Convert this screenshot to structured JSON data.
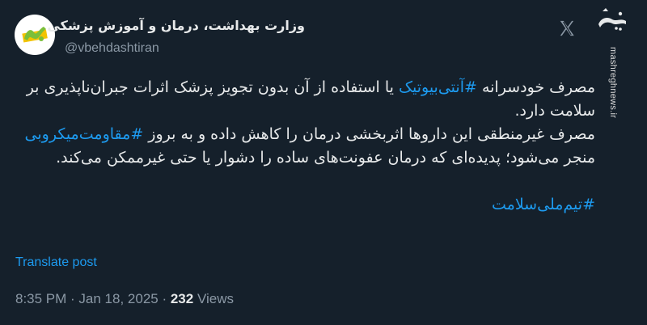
{
  "account": {
    "display_name": "وزارت بهداشت، درمان و آموزش پزشکی",
    "handle": "@vbehdashtiran",
    "avatar_icon": "ministry-logo-icon"
  },
  "header": {
    "platform_icon": "x-logo-icon"
  },
  "watermark": {
    "logo_text": "مشرق",
    "site": "mashreghnews.ir"
  },
  "tweet": {
    "p1_before": "مصرف خودسرانه ",
    "hashtag1": "#آنتی‌بیوتیک",
    "p1_after": " یا استفاده از آن بدون تجویز پزشک اثرات جبران‌ناپذیری بر سلامت دارد.",
    "p2_before": "مصرف غیرمنطقی این داروها اثربخشی درمان را کاهش داده و به بروز ",
    "hashtag2": "#مقاومت‌میکروبی",
    "p2_after": " منجر می‌شود؛ پدیده‌ای که درمان عفونت‌های ساده را دشوار یا حتی غیرممکن می‌کند.",
    "hashtag3": "#تیم‌ملی‌سلامت"
  },
  "actions": {
    "translate": "Translate post"
  },
  "meta": {
    "time": "8:35 PM",
    "separator": " · ",
    "date": "Jan 18, 2025",
    "views_count": "232",
    "views_label": " Views"
  },
  "colors": {
    "background": "#15202b",
    "text": "#e7e9ea",
    "secondary": "#8b98a5",
    "link": "#1d9bf0",
    "avatar_green": "#7bbf3a",
    "avatar_yellow": "#f2c300"
  }
}
